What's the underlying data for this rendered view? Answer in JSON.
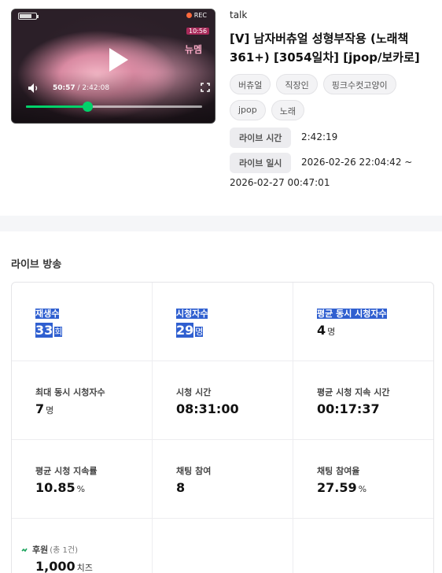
{
  "player": {
    "current_time": "50:57",
    "separator": " / ",
    "duration": "2:42:08",
    "rec_label": "REC",
    "overlay_time": "10:56",
    "sticker": "뉴멤",
    "progress_fraction": 0.35,
    "colors": {
      "accent": "#00d26a"
    }
  },
  "video": {
    "channel": "talk",
    "title": "[V] 남자버츄얼 성형부작용 (노래책 361+) [3054일차] [jpop/보카로]",
    "tags": [
      "버츄얼",
      "직장인",
      "핑크수컷고양이",
      "jpop",
      "노래"
    ],
    "live_time_label": "라이브 시간",
    "live_time_value": "2:42:19",
    "live_date_label": "라이브 일시",
    "live_date_value_1": "2026-02-26 22:04:42 ~",
    "live_date_value_2": "2026-02-27 00:47:01"
  },
  "section": {
    "title": "라이브 방송"
  },
  "stats": [
    {
      "label": "재생수",
      "value": "33",
      "unit": "회",
      "highlight": true
    },
    {
      "label": "시청자수",
      "value": "29",
      "unit": "명",
      "highlight": true
    },
    {
      "label": "평균 동시 시청자수",
      "value": "4",
      "unit": "명",
      "highlight_label": true
    },
    {
      "label": "최대 동시 시청자수",
      "value": "7",
      "unit": "명"
    },
    {
      "label": "시청 시간",
      "value": "08:31:00",
      "unit": ""
    },
    {
      "label": "평균 시청 지속 시간",
      "value": "00:17:37",
      "unit": ""
    },
    {
      "label": "평균 시청 지속률",
      "value": "10.85",
      "unit": "%"
    },
    {
      "label": "채팅 참여",
      "value": "8",
      "unit": ""
    },
    {
      "label": "채팅 참여율",
      "value": "27.59",
      "unit": "%"
    },
    {
      "label": "후원",
      "sub": "(총 1건)",
      "value": "1,000",
      "unit": "치즈"
    }
  ],
  "icons": [
    "play-icon",
    "volume-icon",
    "fullscreen-icon",
    "sponsor-icon"
  ]
}
